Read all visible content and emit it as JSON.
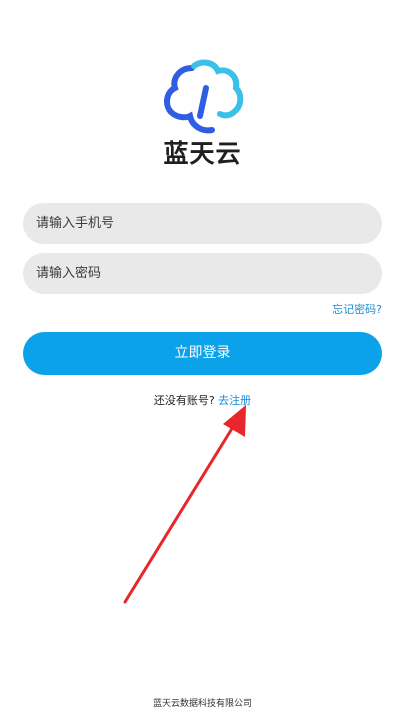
{
  "app": {
    "brand_name": "蓝天云",
    "logo_icon": "cloud-t-logo-icon"
  },
  "form": {
    "phone_placeholder": "请输入手机号",
    "password_placeholder": "请输入密码",
    "forgot_password": "忘记密码?",
    "login_button": "立即登录"
  },
  "register": {
    "prompt": "还没有账号?",
    "link": "去注册"
  },
  "annotation": {
    "arrow_icon": "red-arrow-icon",
    "arrow_color": "#e8262b"
  },
  "footer": {
    "company": "蓝天云数据科技有限公司"
  },
  "colors": {
    "accent": "#0ba2ea",
    "link": "#1a8ad6",
    "field_bg": "#e9e9e9"
  }
}
